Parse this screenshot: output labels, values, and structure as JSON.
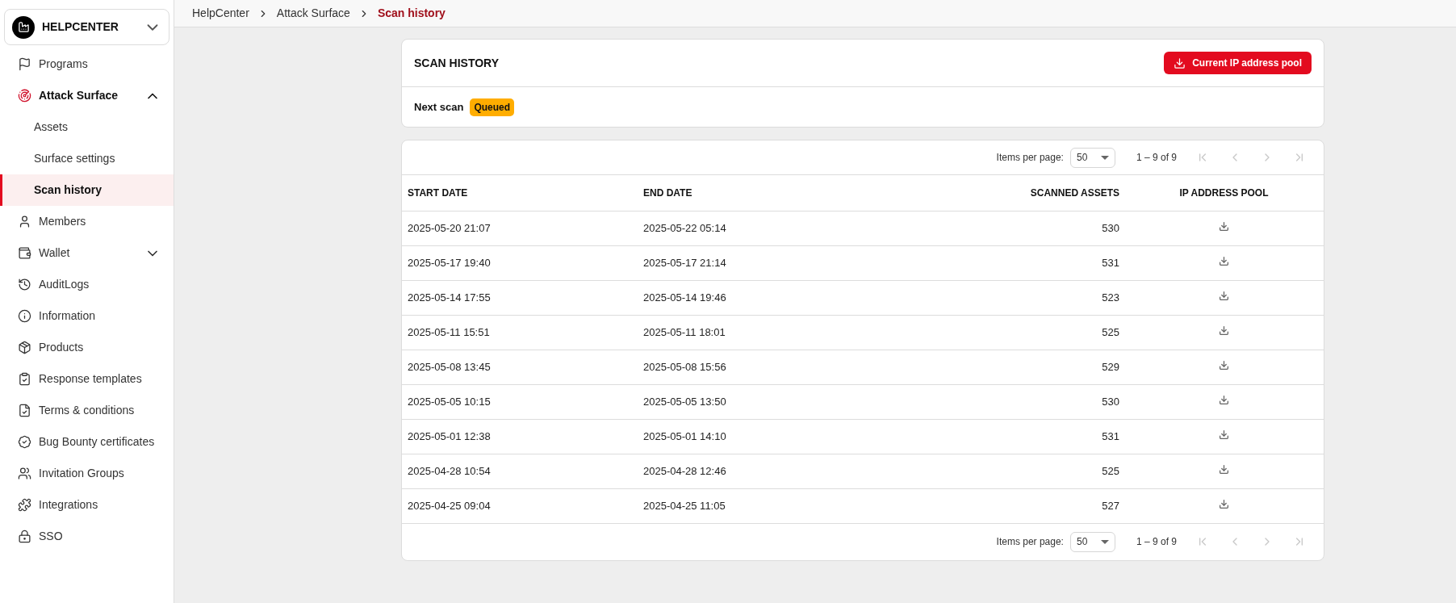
{
  "org": {
    "name": "HELPCENTER"
  },
  "sidebar": {
    "items": [
      {
        "kind": "flag",
        "label": "Programs",
        "selected": false
      },
      {
        "kind": "radar",
        "label": "Attack Surface",
        "selected": false,
        "active": true,
        "expanded": true,
        "children": [
          {
            "label": "Assets",
            "selected": false
          },
          {
            "label": "Surface settings",
            "selected": false
          },
          {
            "label": "Scan history",
            "selected": true
          }
        ]
      },
      {
        "kind": "user",
        "label": "Members",
        "selected": false
      },
      {
        "kind": "wallet",
        "label": "Wallet",
        "selected": false,
        "expanded": false
      },
      {
        "kind": "history",
        "label": "AuditLogs",
        "selected": false
      },
      {
        "kind": "info",
        "label": "Information",
        "selected": false
      },
      {
        "kind": "package",
        "label": "Products",
        "selected": false
      },
      {
        "kind": "clipboard",
        "label": "Response templates",
        "selected": false
      },
      {
        "kind": "file",
        "label": "Terms & conditions",
        "selected": false
      },
      {
        "kind": "badge",
        "label": "Bug Bounty certificates",
        "selected": false
      },
      {
        "kind": "users",
        "label": "Invitation Groups",
        "selected": false
      },
      {
        "kind": "puzzle",
        "label": "Integrations",
        "selected": false
      },
      {
        "kind": "lock",
        "label": "SSO",
        "selected": false
      }
    ]
  },
  "breadcrumb": [
    "HelpCenter",
    "Attack Surface",
    "Scan history"
  ],
  "summary": {
    "title": "SCAN HISTORY",
    "button": "Current IP address pool",
    "next_scan_label": "Next scan",
    "status": "Queued"
  },
  "pagination_top": {
    "label": "Items per page:",
    "per_page": "50",
    "range": "1 – 9 of 9",
    "first_disabled": true,
    "prev_disabled": true,
    "next_disabled": true,
    "last_disabled": true
  },
  "table": {
    "columns": [
      "START DATE",
      "END DATE",
      "SCANNED ASSETS",
      "IP ADDRESS POOL"
    ],
    "rows": [
      [
        "2025-05-20 21:07",
        "2025-05-22 05:14",
        "530"
      ],
      [
        "2025-05-17 19:40",
        "2025-05-17 21:14",
        "531"
      ],
      [
        "2025-05-14 17:55",
        "2025-05-14 19:46",
        "523"
      ],
      [
        "2025-05-11 15:51",
        "2025-05-11 18:01",
        "525"
      ],
      [
        "2025-05-08 13:45",
        "2025-05-08 15:56",
        "529"
      ],
      [
        "2025-05-05 10:15",
        "2025-05-05 13:50",
        "530"
      ],
      [
        "2025-05-01 12:38",
        "2025-05-01 14:10",
        "531"
      ],
      [
        "2025-04-28 10:54",
        "2025-04-28 12:46",
        "525"
      ],
      [
        "2025-04-25 09:04",
        "2025-04-25 11:05",
        "527"
      ]
    ]
  },
  "pagination_bottom": {
    "label": "Items per page:",
    "per_page": "50",
    "range": "1 – 9 of 9",
    "first_disabled": true,
    "prev_disabled": true,
    "next_disabled": true,
    "last_disabled": true
  }
}
